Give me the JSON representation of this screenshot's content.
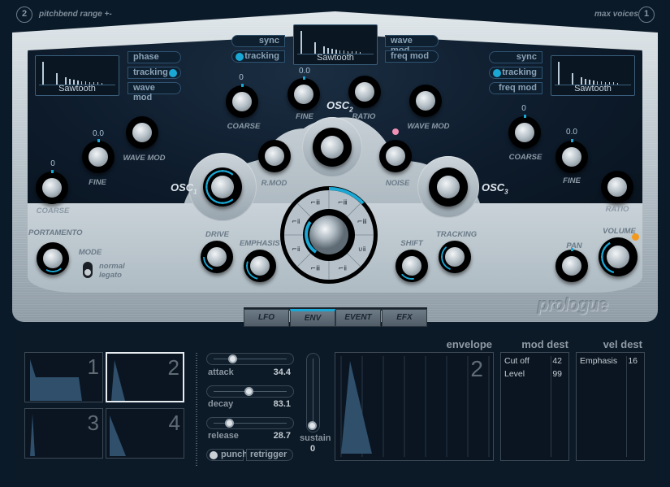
{
  "header": {
    "pitchbend_value": "2",
    "pitchbend_label": "pitchbend range +-",
    "max_voices_label": "max voices",
    "max_voices_value": "1"
  },
  "osc1": {
    "label": "OSC",
    "sub": "1",
    "waveform": "Sawtooth",
    "toggles": [
      {
        "label": "phase",
        "active": false
      },
      {
        "label": "tracking",
        "active": true
      },
      {
        "label": "wave mod",
        "active": false
      }
    ],
    "coarse": {
      "label": "COARSE",
      "value": "0"
    },
    "fine": {
      "label": "FINE",
      "value": "0.0"
    },
    "wave_mod": {
      "label": "WAVE MOD"
    }
  },
  "osc2": {
    "label": "OSC",
    "sub": "2",
    "waveform": "Sawtooth",
    "toggles_left": [
      {
        "label": "sync",
        "active": false
      },
      {
        "label": "tracking",
        "active": true
      }
    ],
    "toggles_right": [
      {
        "label": "wave mod",
        "active": false
      },
      {
        "label": "freq mod",
        "active": false
      }
    ],
    "coarse": {
      "label": "COARSE",
      "value": "0"
    },
    "fine": {
      "label": "FINE",
      "value": "0.0"
    },
    "ratio": {
      "label": "RATIO"
    },
    "wave_mod": {
      "label": "WAVE MOD"
    }
  },
  "osc3": {
    "label": "OSC",
    "sub": "3",
    "waveform": "Sawtooth",
    "toggles": [
      {
        "label": "sync",
        "active": false
      },
      {
        "label": "tracking",
        "active": true
      },
      {
        "label": "freq mod",
        "active": false
      }
    ],
    "coarse": {
      "label": "COARSE",
      "value": "0"
    },
    "fine": {
      "label": "FINE",
      "value": "0.0"
    },
    "ratio": {
      "label": "RATIO"
    }
  },
  "mixer": {
    "rmod_label": "R.MOD",
    "noise_label": "NOISE"
  },
  "filter": {
    "drive_label": "DRIVE",
    "emphasis_label": "EMPHASIS",
    "shift_label": "SHIFT",
    "tracking_label": "TRACKING",
    "types": [
      "lp24",
      "lp18",
      "lp12",
      "bp12",
      "bp24",
      "hp12",
      "hp24",
      "notch",
      "bp6",
      "lp6"
    ],
    "selected_type_index": 0
  },
  "global": {
    "portamento_label": "PORTAMENTO",
    "mode_label": "MODE",
    "mode_options": [
      "normal",
      "legato"
    ],
    "mode_selected": "legato",
    "pan_label": "PAN",
    "volume_label": "VOLUME"
  },
  "brand": "prologue",
  "tabs": [
    {
      "label": "LFO",
      "active": false
    },
    {
      "label": "ENV",
      "active": true
    },
    {
      "label": "EVENT",
      "active": false
    },
    {
      "label": "EFX",
      "active": false
    }
  ],
  "env": {
    "thumbs": [
      {
        "num": "1",
        "selected": false
      },
      {
        "num": "2",
        "selected": true
      },
      {
        "num": "3",
        "selected": false
      },
      {
        "num": "4",
        "selected": false
      }
    ],
    "attack": {
      "label": "attack",
      "value": "34.4",
      "position": 0.22
    },
    "decay": {
      "label": "decay",
      "value": "83.1",
      "position": 0.48
    },
    "release": {
      "label": "release",
      "value": "28.7",
      "position": 0.17
    },
    "sustain": {
      "label": "sustain",
      "value": "0",
      "position": 0
    },
    "punch_label": "punch",
    "punch_active": false,
    "retrigger_label": "retrigger",
    "envelope_title": "envelope",
    "envelope_number": "2"
  },
  "mod_dest": {
    "title": "mod dest",
    "rows": [
      {
        "name": "Cut off",
        "value": "42"
      },
      {
        "name": "Level",
        "value": "99"
      }
    ]
  },
  "vel_dest": {
    "title": "vel dest",
    "rows": [
      {
        "name": "Emphasis",
        "value": "16"
      }
    ]
  },
  "colors": {
    "accent": "#1aa7d4",
    "led_pink": "#f08fb4",
    "led_orange": "#f39a1e"
  }
}
